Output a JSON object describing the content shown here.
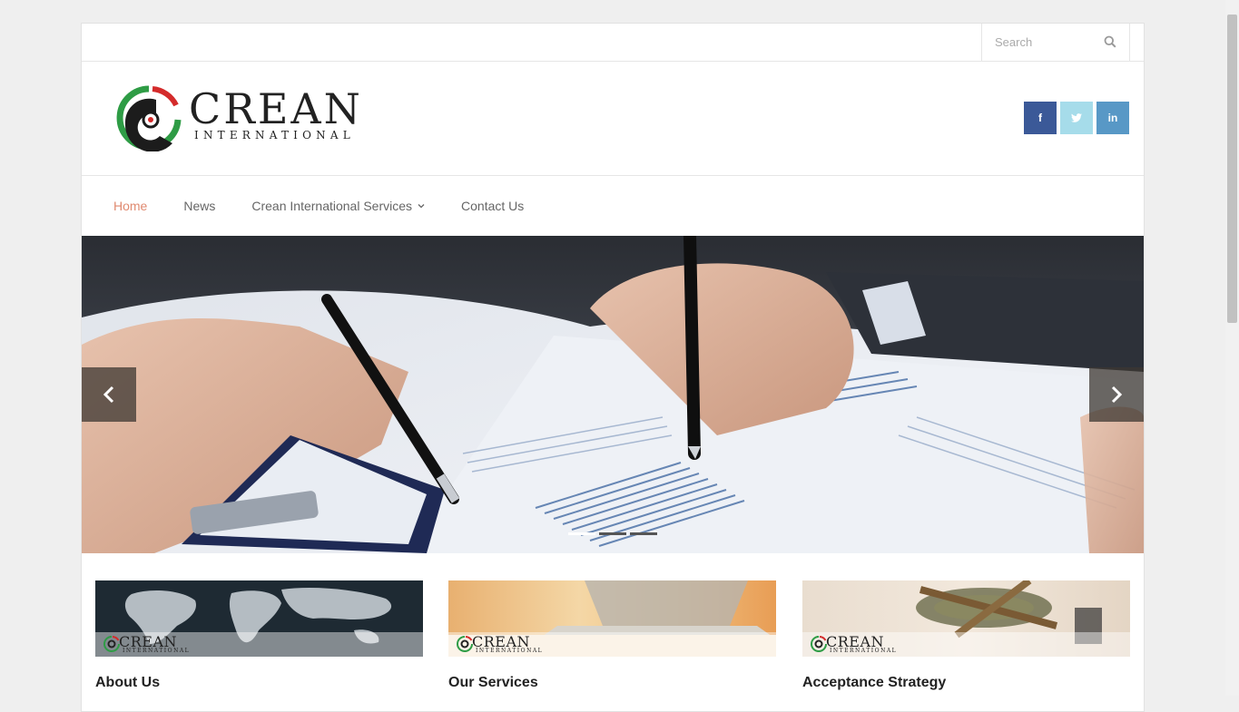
{
  "search": {
    "placeholder": "Search"
  },
  "logo": {
    "word": "CREAN",
    "sub": "INTERNATIONAL"
  },
  "social": {
    "facebook": "f",
    "twitter": "t",
    "linkedin": "in"
  },
  "nav": {
    "items": [
      {
        "label": "Home",
        "active": true
      },
      {
        "label": "News"
      },
      {
        "label": "Crean International Services",
        "dropdown": true
      },
      {
        "label": "Contact Us"
      }
    ]
  },
  "slider": {
    "slide_count": 3,
    "active_slide": 1
  },
  "cards": [
    {
      "title": "About Us",
      "brand": "CREAN",
      "brand_sub": "INTERNATIONAL"
    },
    {
      "title": "Our Services",
      "brand": "CREAN",
      "brand_sub": "INTERNATIONAL"
    },
    {
      "title": "Acceptance Strategy",
      "brand": "CREAN",
      "brand_sub": "INTERNATIONAL"
    }
  ],
  "colors": {
    "accent": "#e08a70",
    "facebook": "#3b5998",
    "twitter": "#a6dcea",
    "linkedin": "#5898c6"
  }
}
